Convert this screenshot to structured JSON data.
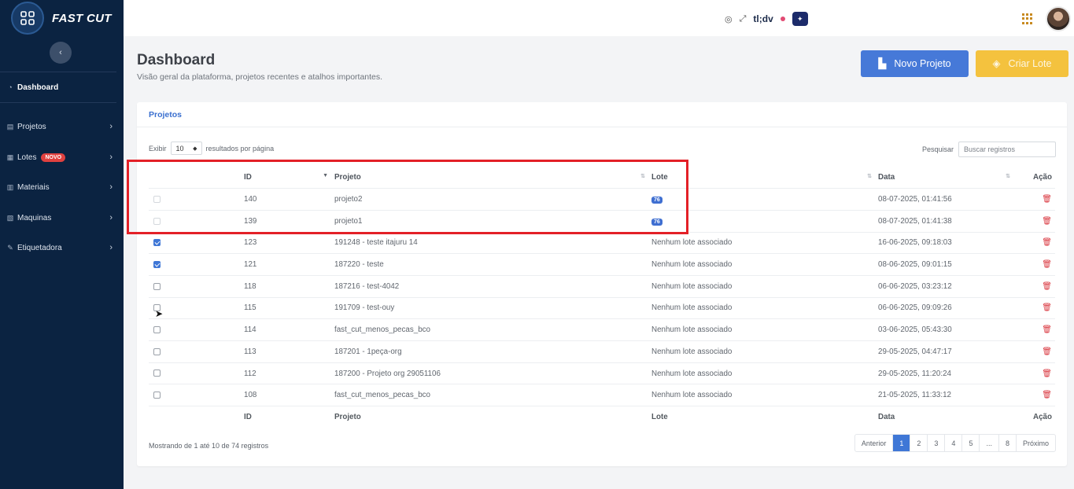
{
  "brand": {
    "name": "FAST CUT",
    "logo_icon": "grid-logo-icon"
  },
  "sidebar": {
    "items": [
      {
        "label": "Dashboard",
        "icon": "dashboard-icon",
        "active": true
      },
      {
        "label": "Projetos",
        "icon": "projects-icon",
        "chevron": "›"
      },
      {
        "label": "Lotes",
        "icon": "batch-icon",
        "badge": "NOVO",
        "chevron": "›"
      },
      {
        "label": "Materiais",
        "icon": "materials-icon",
        "chevron": "›"
      },
      {
        "label": "Maquinas",
        "icon": "machine-icon",
        "chevron": "›"
      },
      {
        "label": "Etiquetadora",
        "icon": "label-icon",
        "chevron": "›"
      }
    ]
  },
  "topbar": {
    "tldv_label": "tl;dv"
  },
  "header": {
    "title": "Dashboard",
    "subtitle": "Visão geral da plataforma, projetos recentes e atalhos importantes.",
    "btn_novo_projeto": "Novo Projeto",
    "btn_criar_lote": "Criar Lote"
  },
  "colors": {
    "primary": "#4679d8",
    "warning": "#f4c23e",
    "sidebar": "#0b2341",
    "danger": "#d9363e"
  },
  "card": {
    "title": "Projetos",
    "length_prefix": "Exibir",
    "length_value": "10",
    "length_suffix": "resultados por página",
    "search_label": "Pesquisar",
    "search_placeholder": "Buscar registros",
    "columns": {
      "id": "ID",
      "projeto": "Projeto",
      "lote": "Lote",
      "data": "Data",
      "acao": "Ação"
    },
    "rows": [
      {
        "checked": false,
        "faint": true,
        "id": "140",
        "projeto": "projeto2",
        "lote": "",
        "lote_badge": "76",
        "data": "08-07-2025, 01:41:56"
      },
      {
        "checked": false,
        "faint": true,
        "id": "139",
        "projeto": "projeto1",
        "lote": "",
        "lote_badge": "76",
        "data": "08-07-2025, 01:41:38"
      },
      {
        "checked": true,
        "id": "123",
        "projeto": "191248 - teste itajuru 14",
        "lote": "Nenhum lote associado",
        "data": "16-06-2025, 09:18:03"
      },
      {
        "checked": true,
        "id": "121",
        "projeto": "187220 - teste",
        "lote": "Nenhum lote associado",
        "data": "08-06-2025, 09:01:15"
      },
      {
        "checked": false,
        "id": "118",
        "projeto": "187216 - test-4042",
        "lote": "Nenhum lote associado",
        "data": "06-06-2025, 03:23:12"
      },
      {
        "checked": false,
        "id": "115",
        "projeto": "191709 - test-ouy",
        "lote": "Nenhum lote associado",
        "data": "06-06-2025, 09:09:26"
      },
      {
        "checked": false,
        "id": "114",
        "projeto": "fast_cut_menos_pecas_bco",
        "lote": "Nenhum lote associado",
        "data": "03-06-2025, 05:43:30"
      },
      {
        "checked": false,
        "id": "113",
        "projeto": "187201 - 1peça-org",
        "lote": "Nenhum lote associado",
        "data": "29-05-2025, 04:47:17"
      },
      {
        "checked": false,
        "id": "112",
        "projeto": "187200 - Projeto org 29051106",
        "lote": "Nenhum lote associado",
        "data": "29-05-2025, 11:20:24"
      },
      {
        "checked": false,
        "id": "108",
        "projeto": "fast_cut_menos_pecas_bco",
        "lote": "Nenhum lote associado",
        "data": "21-05-2025, 11:33:12"
      }
    ],
    "info": "Mostrando de 1 até 10 de 74 registros",
    "pagination": [
      "Anterior",
      "1",
      "2",
      "3",
      "4",
      "5",
      "...",
      "8",
      "Próximo"
    ],
    "current_page": "1"
  }
}
